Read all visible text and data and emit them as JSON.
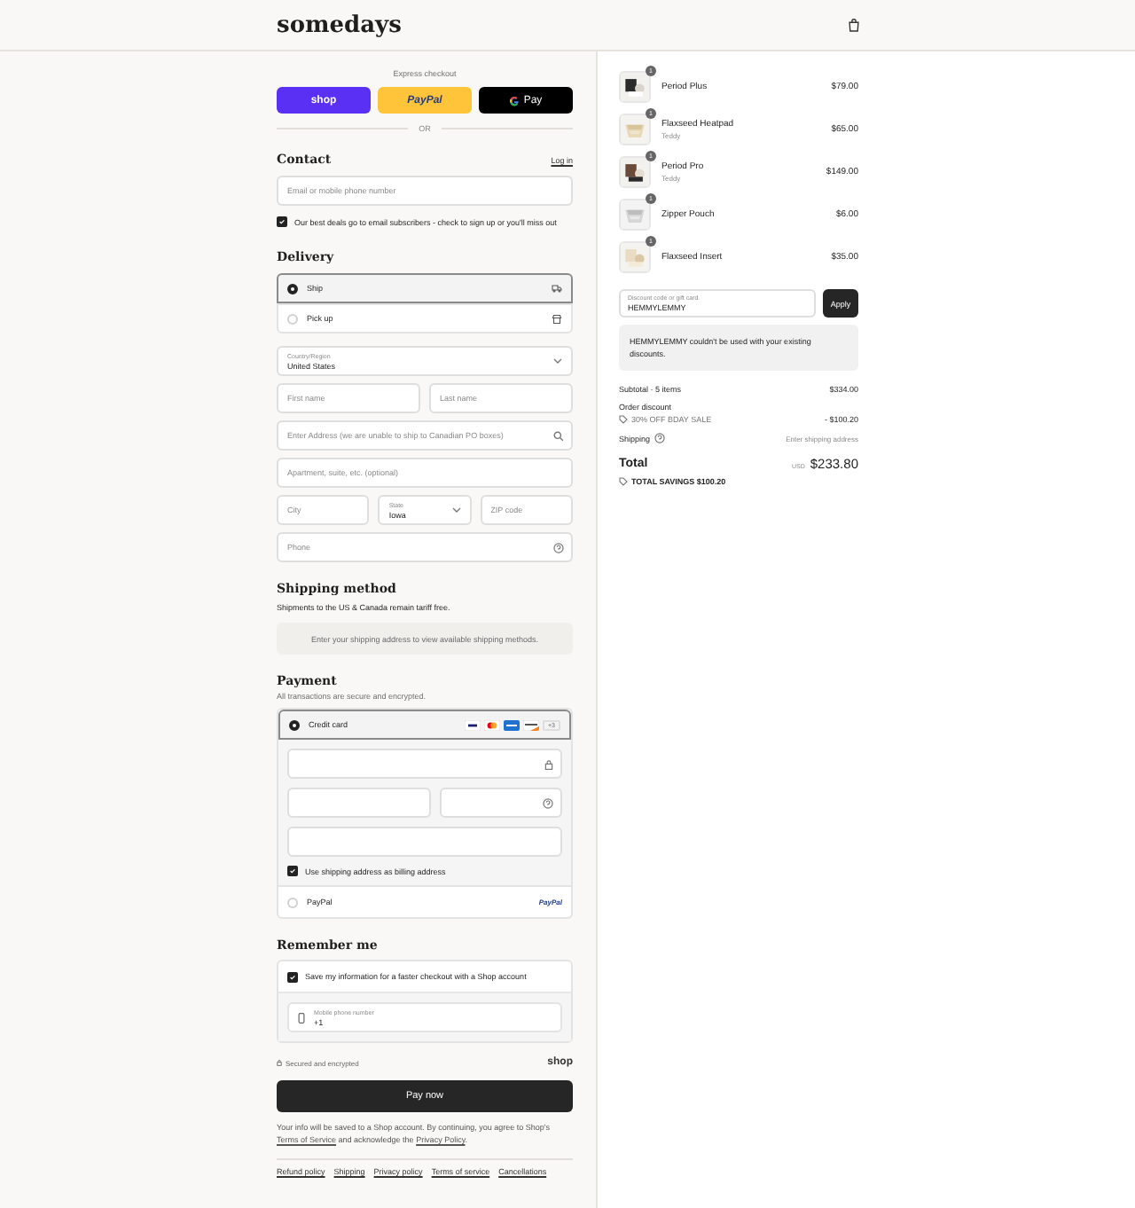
{
  "header": {
    "brand": "somedays"
  },
  "express": {
    "title": "Express checkout",
    "buttons": [
      {
        "label": "shop",
        "kind": "shop"
      },
      {
        "label": "PayPal",
        "kind": "paypal"
      },
      {
        "label": "Pay",
        "kind": "gpay"
      }
    ],
    "divider": "OR"
  },
  "contact": {
    "title": "Contact",
    "login": "Log in",
    "email_placeholder": "Email or mobile phone number",
    "subscribe": {
      "label": "Our best deals go to email subscribers - check to sign up or you'll miss out",
      "checked": true
    }
  },
  "delivery": {
    "title": "Delivery",
    "options": [
      {
        "label": "Ship",
        "kind": "ship",
        "selected": true
      },
      {
        "label": "Pick up",
        "kind": "pickup",
        "selected": false
      }
    ],
    "rows": [
      [
        {
          "kind": "select",
          "label": "Country/Region",
          "value": "United States"
        }
      ],
      [
        {
          "kind": "text",
          "placeholder": "First name"
        },
        {
          "kind": "text",
          "placeholder": "Last name"
        }
      ],
      [
        {
          "kind": "search",
          "placeholder": "Enter Address (we are unable to ship to Canadian PO boxes)"
        }
      ],
      [
        {
          "kind": "text",
          "placeholder": "Apartment, suite, etc. (optional)"
        }
      ],
      [
        {
          "kind": "text",
          "placeholder": "City"
        },
        {
          "kind": "select",
          "label": "State",
          "value": "Iowa"
        },
        {
          "kind": "text",
          "placeholder": "ZIP code"
        }
      ],
      [
        {
          "kind": "help",
          "placeholder": "Phone"
        }
      ]
    ]
  },
  "shipping_method": {
    "title": "Shipping method",
    "note": "Shipments to the US & Canada remain tariff free.",
    "notice": "Enter your shipping address to view available shipping methods."
  },
  "payment": {
    "title": "Payment",
    "subtitle": "All transactions are secure and encrypted.",
    "methods": [
      {
        "label": "Credit card",
        "kind": "card",
        "selected": true,
        "more": "+3"
      },
      {
        "label": "PayPal",
        "kind": "paypal",
        "selected": false,
        "logo": "PayPal"
      }
    ],
    "billing": {
      "label": "Use shipping address as billing address",
      "checked": true
    }
  },
  "remember": {
    "title": "Remember me",
    "save": {
      "label": "Save my information for a faster checkout with a Shop account",
      "checked": true
    },
    "phone": {
      "label": "Mobile phone number",
      "value": "+1"
    }
  },
  "secure": "Secured and encrypted",
  "shop_logo": "shop",
  "pay_button": "Pay now",
  "legal": [
    {
      "text": "Your info will be saved to a Shop account. By continuing, you agree to Shop's "
    },
    {
      "text": "Terms of Service",
      "kind": "link"
    },
    {
      "text": " and acknowledge the "
    },
    {
      "text": "Privacy Policy",
      "kind": "link"
    },
    {
      "text": "."
    }
  ],
  "footer_links": [
    "Refund policy",
    "Shipping",
    "Privacy policy",
    "Terms of service",
    "Cancellations"
  ],
  "items": [
    {
      "name": "Period Plus",
      "price": "$79.00",
      "quantity": "1"
    },
    {
      "name": "Flaxseed Heatpad",
      "variant": "Teddy",
      "price": "$65.00",
      "quantity": "1"
    },
    {
      "name": "Period Pro",
      "variant": "Teddy",
      "price": "$149.00",
      "quantity": "1"
    },
    {
      "name": "Zipper Pouch",
      "price": "$6.00",
      "quantity": "1"
    },
    {
      "name": "Flaxseed Insert",
      "price": "$35.00",
      "quantity": "1"
    }
  ],
  "discount": {
    "label": "Discount code or gift card",
    "value": "HEMMYLEMMY",
    "button": "Apply",
    "error": "HEMMYLEMMY couldn't be used with your existing discounts."
  },
  "summary": {
    "subtotal_label": "Subtotal · 5 items",
    "subtotal": "$334.00",
    "order_discount": "Order discount",
    "discount_code": "30% OFF BDAY SALE",
    "discount_amount": "- $100.20",
    "shipping_label": "Shipping",
    "shipping_value": "Enter shipping address",
    "total_label": "Total",
    "currency": "USD",
    "total": "$233.80",
    "savings": "TOTAL SAVINGS $100.20"
  }
}
